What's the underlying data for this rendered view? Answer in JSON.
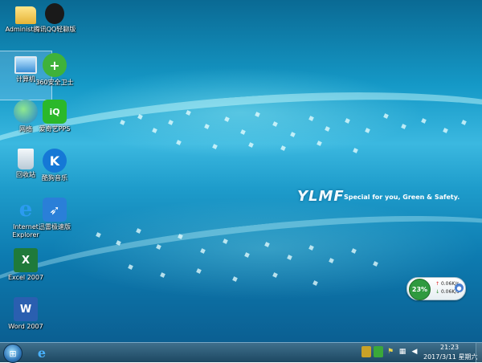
{
  "desktop": {
    "icons": [
      {
        "label": "Administra...",
        "icon": "user-folder-icon"
      },
      {
        "label": "腾讯QQ轻聊版",
        "icon": "qq-icon"
      },
      {
        "label": "计算机",
        "icon": "computer-icon"
      },
      {
        "label": "360安全卫士",
        "icon": "360-safe-icon"
      },
      {
        "label": "网络",
        "icon": "network-icon"
      },
      {
        "label": "爱奇艺PPS",
        "icon": "iqiyi-icon"
      },
      {
        "label": "回收站",
        "icon": "recycle-bin-icon"
      },
      {
        "label": "酷狗音乐",
        "icon": "kugou-icon"
      },
      {
        "label": "Internet Explorer",
        "icon": "internet-explorer-icon"
      },
      {
        "label": "迅雷极速版",
        "icon": "xunlei-icon"
      },
      {
        "label": "Excel 2007",
        "icon": "excel-icon"
      },
      {
        "label": "Word 2007",
        "icon": "word-icon"
      }
    ],
    "wallpaper": {
      "logo": "YLMF",
      "tagline": "Special for you, Green & Safety."
    }
  },
  "net_monitor": {
    "percent": "23%",
    "upload": "0.06K/s",
    "download": "0.06K/s"
  },
  "taskbar": {
    "clock_time": "21:23",
    "clock_date": "2017/3/11 星期六",
    "tray_icons": [
      "action-center-icon",
      "security-shield-icon",
      "flag-icon",
      "network-tray-icon",
      "volume-icon"
    ]
  },
  "colors": {
    "wallpaper_main": "#1599c7",
    "taskbar": "#1d4862",
    "netmon_green": "#2f9a3f"
  }
}
